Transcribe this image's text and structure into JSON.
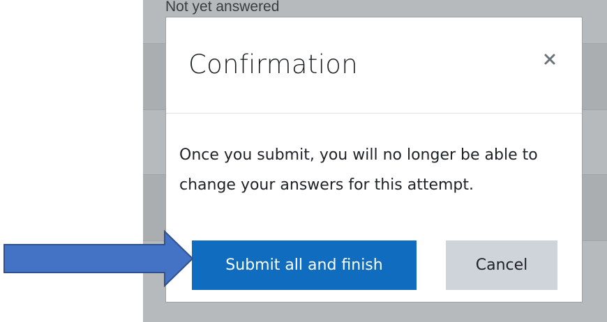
{
  "background": {
    "status_text": "Not yet answered"
  },
  "modal": {
    "title": "Confirmation",
    "close_icon": "close-icon",
    "message": "Once you submit, you will no longer be able to change your answers for this attempt.",
    "submit_label": "Submit all and finish",
    "cancel_label": "Cancel"
  },
  "annotation": {
    "arrow_icon": "right-arrow-icon",
    "arrow_color": "#4472c4"
  },
  "colors": {
    "primary": "#0f6cbf",
    "secondary": "#ced4da",
    "backdrop": "#b7babd"
  }
}
